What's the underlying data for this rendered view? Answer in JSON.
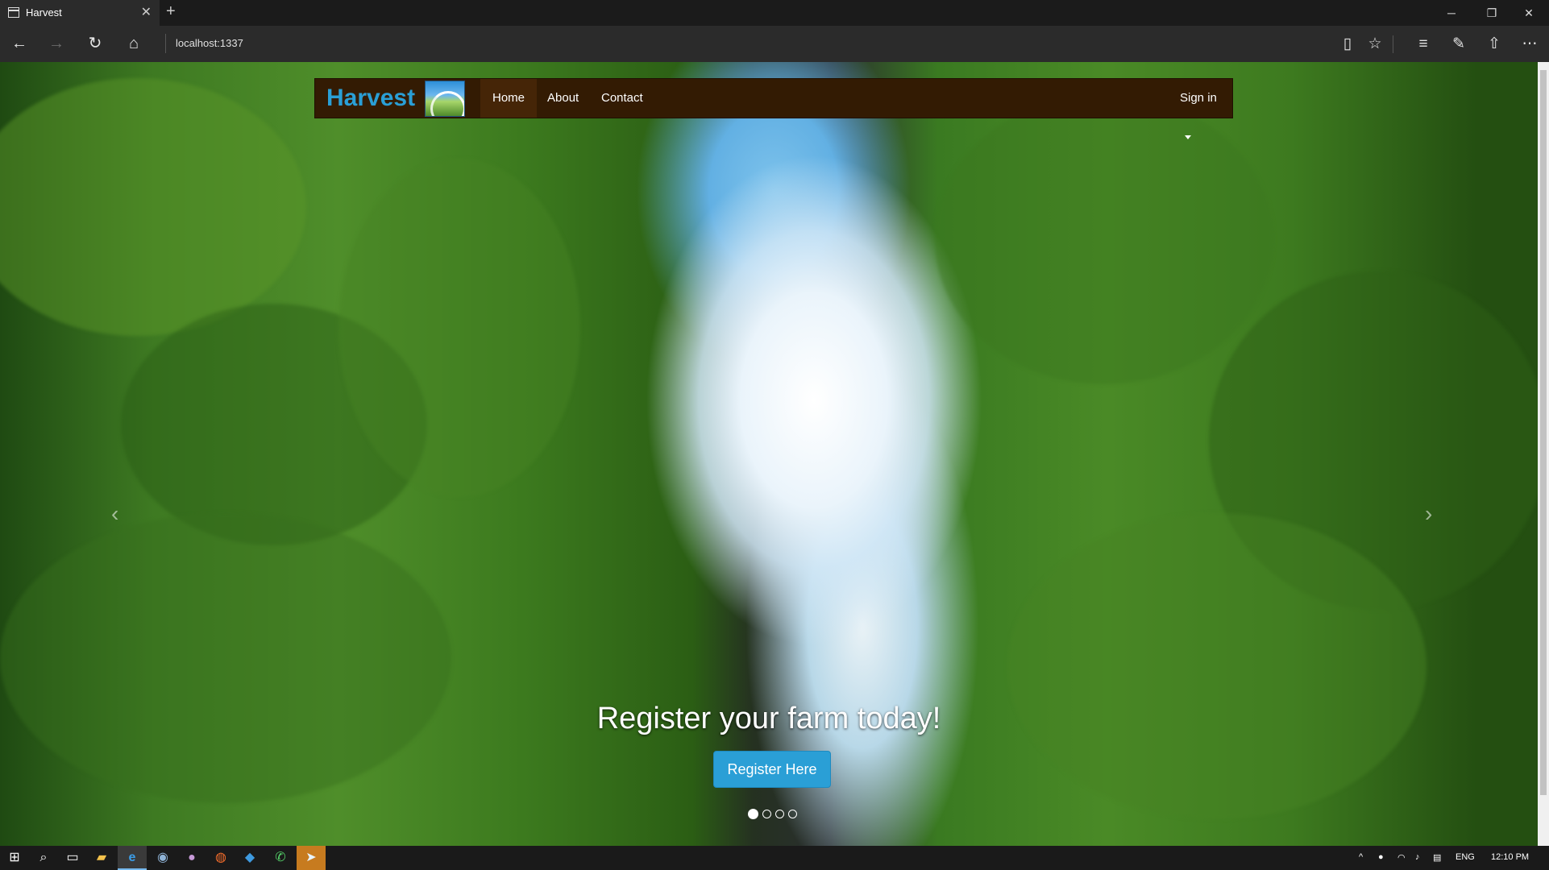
{
  "browser": {
    "tab_title": "Harvest",
    "new_tab_icon": "plus-icon",
    "url": "localhost:1337",
    "window_controls": [
      "minimize-icon",
      "restore-icon",
      "close-icon"
    ],
    "toolbar_icons": [
      "reading-view-icon",
      "favorite-star-icon",
      "hub-icon",
      "web-note-icon",
      "share-icon",
      "more-icon"
    ]
  },
  "site": {
    "brand": "Harvest",
    "nav": [
      {
        "label": "Home",
        "active": true
      },
      {
        "label": "About",
        "active": false
      },
      {
        "label": "Contact",
        "active": false
      }
    ],
    "signin_label": "Sign in",
    "brand_color": "#2a9fd6",
    "navbar_color": "#331b03"
  },
  "carousel": {
    "caption": "Register your farm today!",
    "button_label": "Register Here",
    "slide_count": 4,
    "active_slide": 1,
    "prev_arrow": "‹",
    "next_arrow": "›"
  },
  "taskbar": {
    "language": "ENG",
    "time": "12:10 PM"
  }
}
